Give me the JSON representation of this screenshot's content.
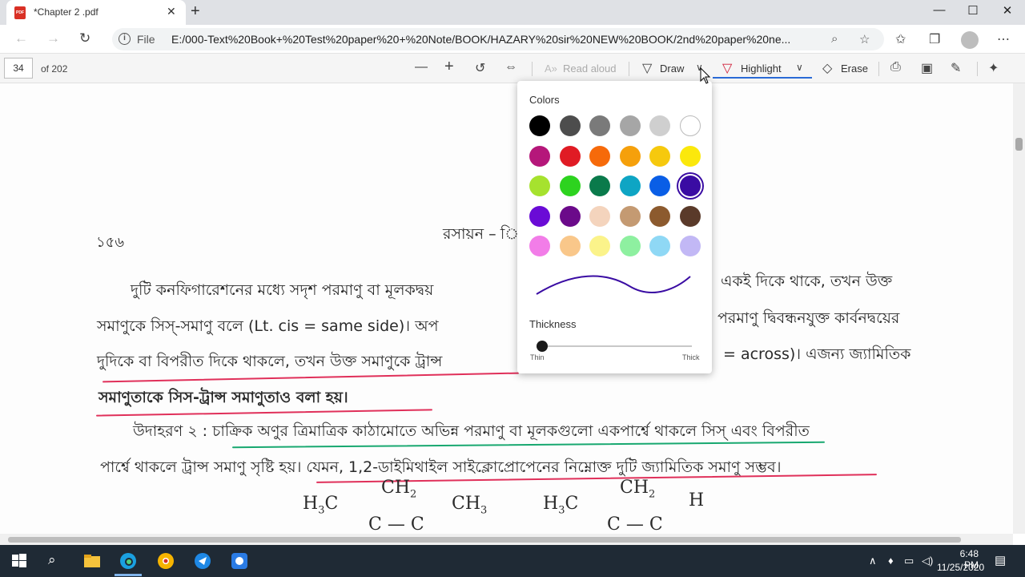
{
  "browser": {
    "tab_title": "*Chapter 2 .pdf",
    "tab_pdf_badge": "PDF",
    "tab_close": "✕",
    "new_tab": "+",
    "file_label": "File",
    "url": "E:/000-Text%20Book+%20Test%20paper%20+%20Note/BOOK/HAZARY%20sir%20NEW%20BOOK/2nd%20paper%20ne...",
    "window_controls": {
      "minimize": "—",
      "maximize": "☐",
      "close": "✕"
    }
  },
  "pdf_toolbar": {
    "page_number": "34",
    "page_total": "of 202",
    "read_aloud": "Read aloud",
    "draw": "Draw",
    "highlight": "Highlight",
    "erase": "Erase"
  },
  "highlight_popup": {
    "colors_label": "Colors",
    "thickness_label": "Thickness",
    "thin_label": "Thin",
    "thick_label": "Thick",
    "thickness_value": 0.0,
    "selected_color": "#3a0ca3",
    "colors": [
      [
        "#000000",
        "#4d4d4d",
        "#7a7a7a",
        "#a6a6a6",
        "#cfcfcf",
        "#ffffff"
      ],
      [
        "#b5177a",
        "#e01b24",
        "#f66a0a",
        "#f5a00b",
        "#f6c90e",
        "#fbe80c"
      ],
      [
        "#a6e22e",
        "#2dd31f",
        "#0a7a4b",
        "#0ea5c4",
        "#0a5ee6",
        "#3a0ca3"
      ],
      [
        "#6a0bd6",
        "#6b0a8a",
        "#f4d4bd",
        "#c49a72",
        "#8c5a2e",
        "#5a3a2a"
      ],
      [
        "#f27de8",
        "#f9c78a",
        "#fbf38a",
        "#8ef0a0",
        "#8fd8f5",
        "#c2b8f5"
      ]
    ],
    "stroke_color": "#3a0ca3"
  },
  "document": {
    "page_no": "১৫৬",
    "header": "রসায়ন – ি",
    "lines": [
      "দুটি কনফিগারেশনের মধ্যে সদৃশ পরমাণু বা মূলকদ্বয়",
      "একই দিকে থাকে, তখন উক্ত",
      "সমাণুকে সিস্‌-সমাণু বলে  (Lt. cis = same side)। অপ",
      "পরমাণু দ্বিবন্ধনযুক্ত কার্বনদ্বয়ের",
      "দুদিকে বা বিপরীত দিকে থাকলে, তখন উক্ত সমাণুকে ট্রান্স",
      "= across)। এজন্য জ্যামিতিক",
      "সমাণুতাকে সিস-ট্রান্স সমাণুতাও বলা হয়।",
      "উদাহরণ ২ : চাক্রিক অণুর ত্রিমাত্রিক কাঠামোতে অভিন্ন পরমাণু বা মূলকগুলো একপার্শ্বে থাকলে সিস্‌ এবং বিপরীত",
      "পার্শ্বে থাকলে ট্রান্স সমাণু সৃষ্টি হয়। যেমন, 1,2-ডাইমিথাইল সাইক্লোপ্রোপেনের নিম্নোক্ত দুটি জ্যামিতিক সমাণু সম্ভব।"
    ],
    "chem_left": {
      "top": "CH",
      "top_sub": "2",
      "left": "H",
      "left_sub": "3",
      "left_c": "C",
      "right": "CH",
      "right_sub": "3",
      "bottom": "C — C"
    },
    "chem_right": {
      "top": "CH",
      "top_sub": "2",
      "left": "H",
      "left_sub": "3",
      "left_c": "C",
      "right": "H",
      "bottom": "C — C"
    }
  },
  "taskbar": {
    "time": "6:48 PM",
    "date": "11/25/2020"
  }
}
